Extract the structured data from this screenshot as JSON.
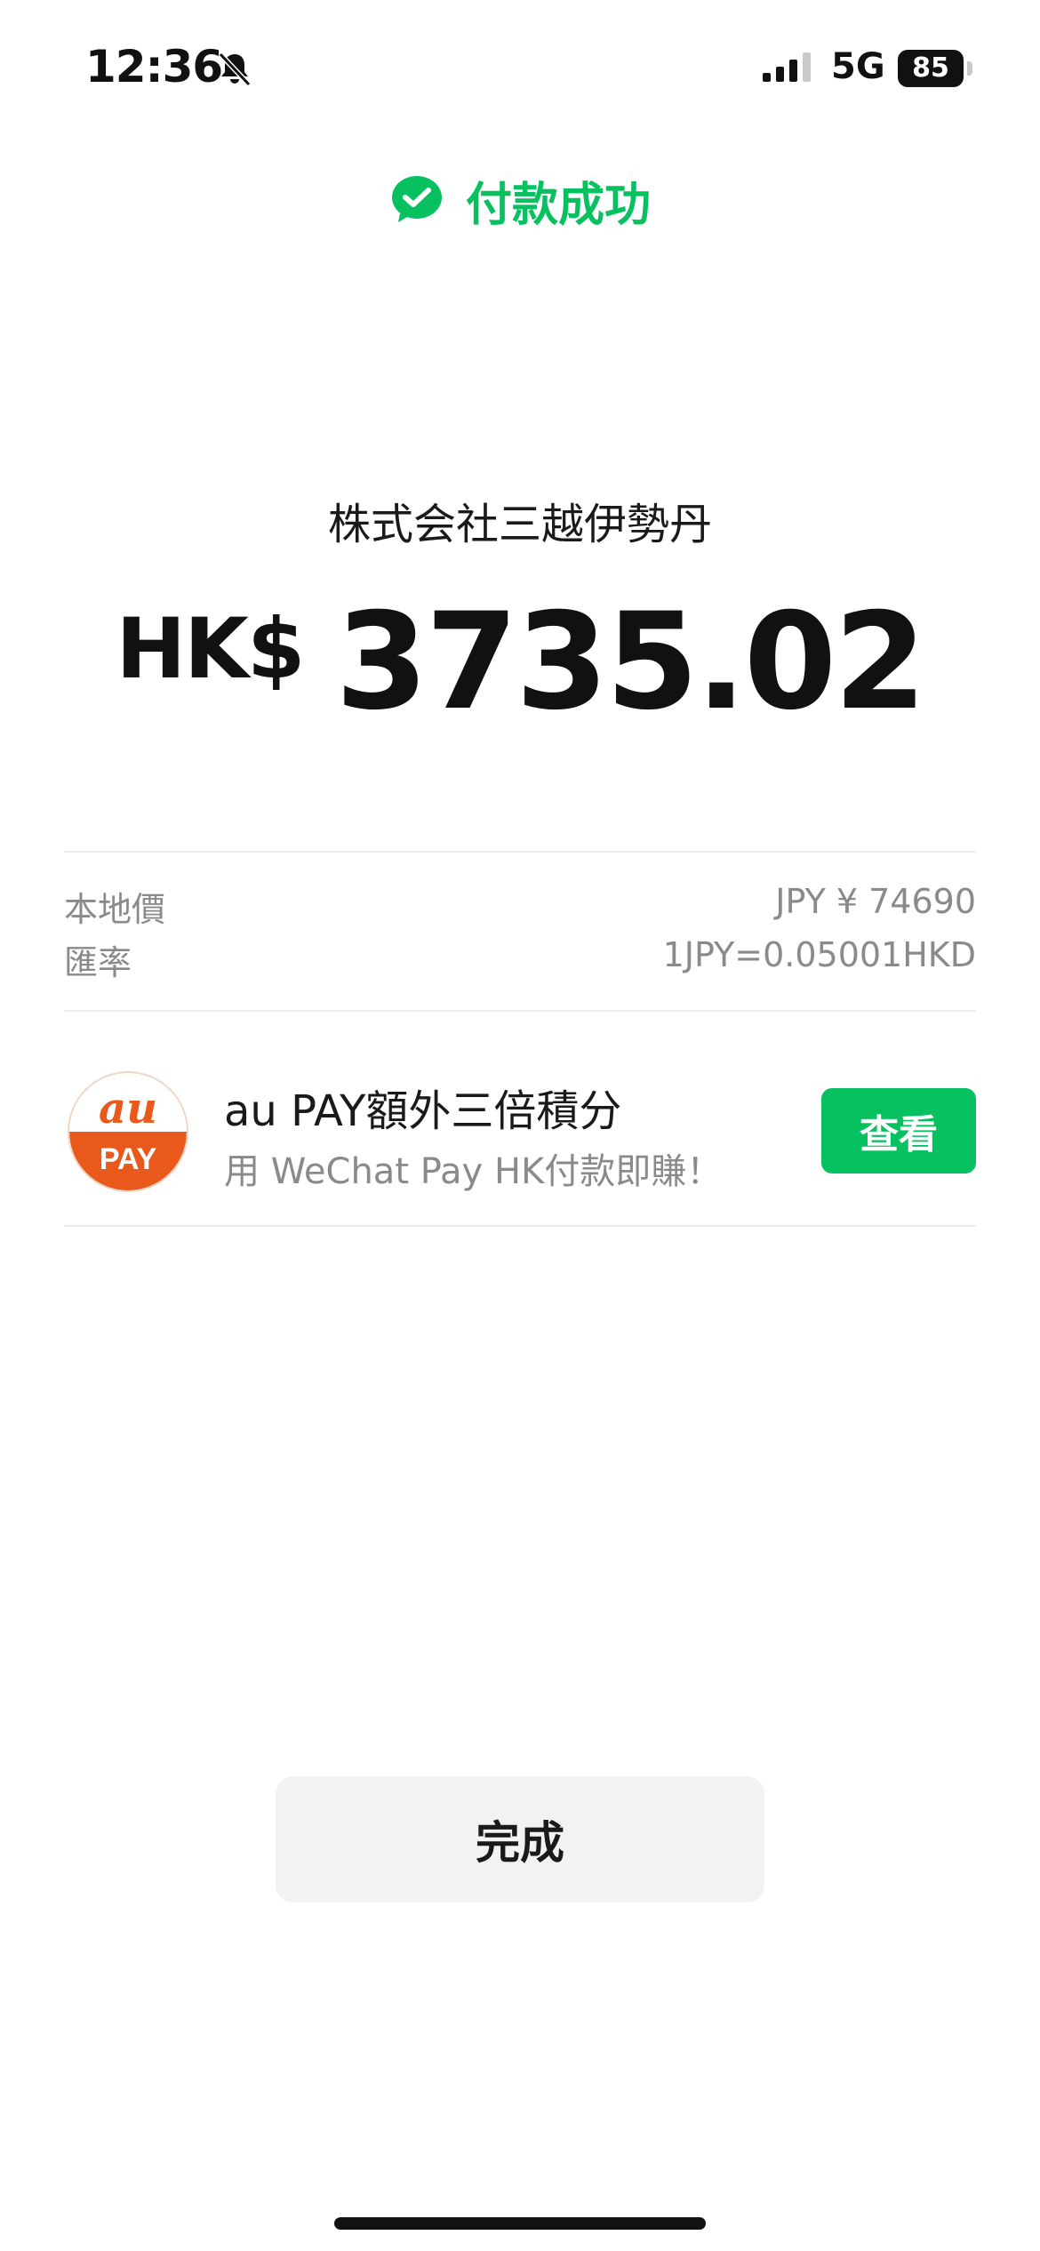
{
  "status_bar": {
    "time": "12:36",
    "network": "5G",
    "battery": "85"
  },
  "header": {
    "status": "付款成功"
  },
  "payment": {
    "merchant": "株式会社三越伊勢丹",
    "currency": "HK$",
    "amount": "3735.02"
  },
  "details": [
    {
      "label": "本地價",
      "value": "JPY ¥ 74690"
    },
    {
      "label": "匯率",
      "value": "1JPY=0.05001HKD"
    }
  ],
  "promo": {
    "logo_top": "au",
    "logo_bottom": "PAY",
    "title": "au PAY額外三倍積分",
    "subtitle": "用 WeChat Pay HK付款即賺！",
    "button": "查看"
  },
  "actions": {
    "done": "完成"
  },
  "colors": {
    "accent": "#07c160",
    "au_orange": "#e8591b"
  }
}
